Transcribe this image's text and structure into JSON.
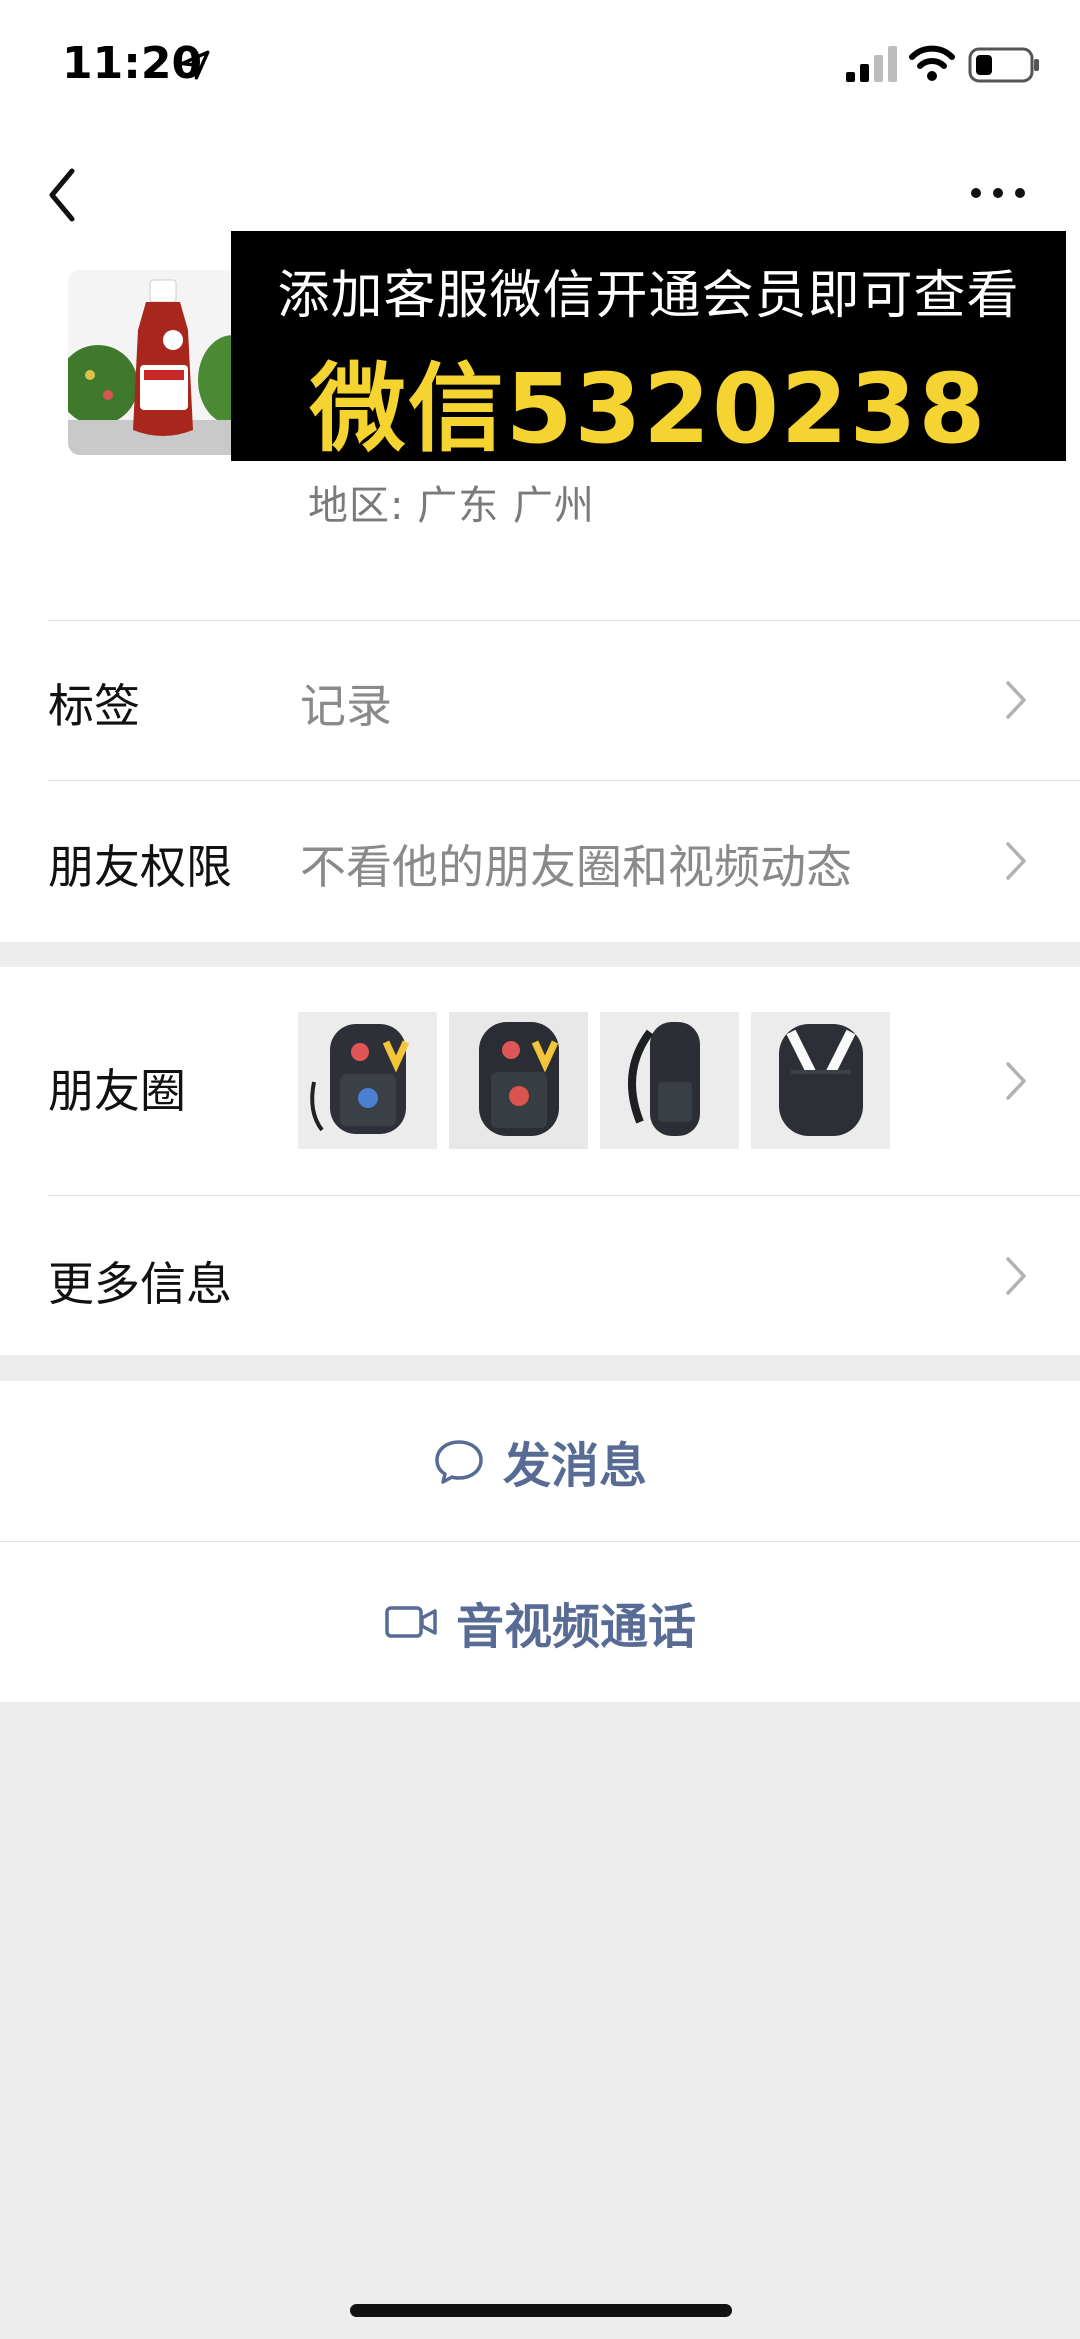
{
  "status_bar": {
    "time": "11:20"
  },
  "profile": {
    "region_label": "地区:",
    "region_value": "广东 广州"
  },
  "banner": {
    "line1": "添加客服微信开通会员即可查看",
    "line2": "微信5320238",
    "accent_color": "#f5d330"
  },
  "rows": {
    "tags": {
      "label": "标签",
      "value": "记录"
    },
    "permissions": {
      "label": "朋友权限",
      "value": "不看他的朋友圈和视频动态"
    },
    "moments": {
      "label": "朋友圈"
    },
    "more_info": {
      "label": "更多信息"
    }
  },
  "actions": {
    "message": {
      "label": "发消息",
      "icon": "chat-bubble-icon"
    },
    "call": {
      "label": "音视频通话",
      "icon": "video-camera-icon"
    }
  },
  "colors": {
    "link": "#576b95",
    "background": "#ededed"
  }
}
